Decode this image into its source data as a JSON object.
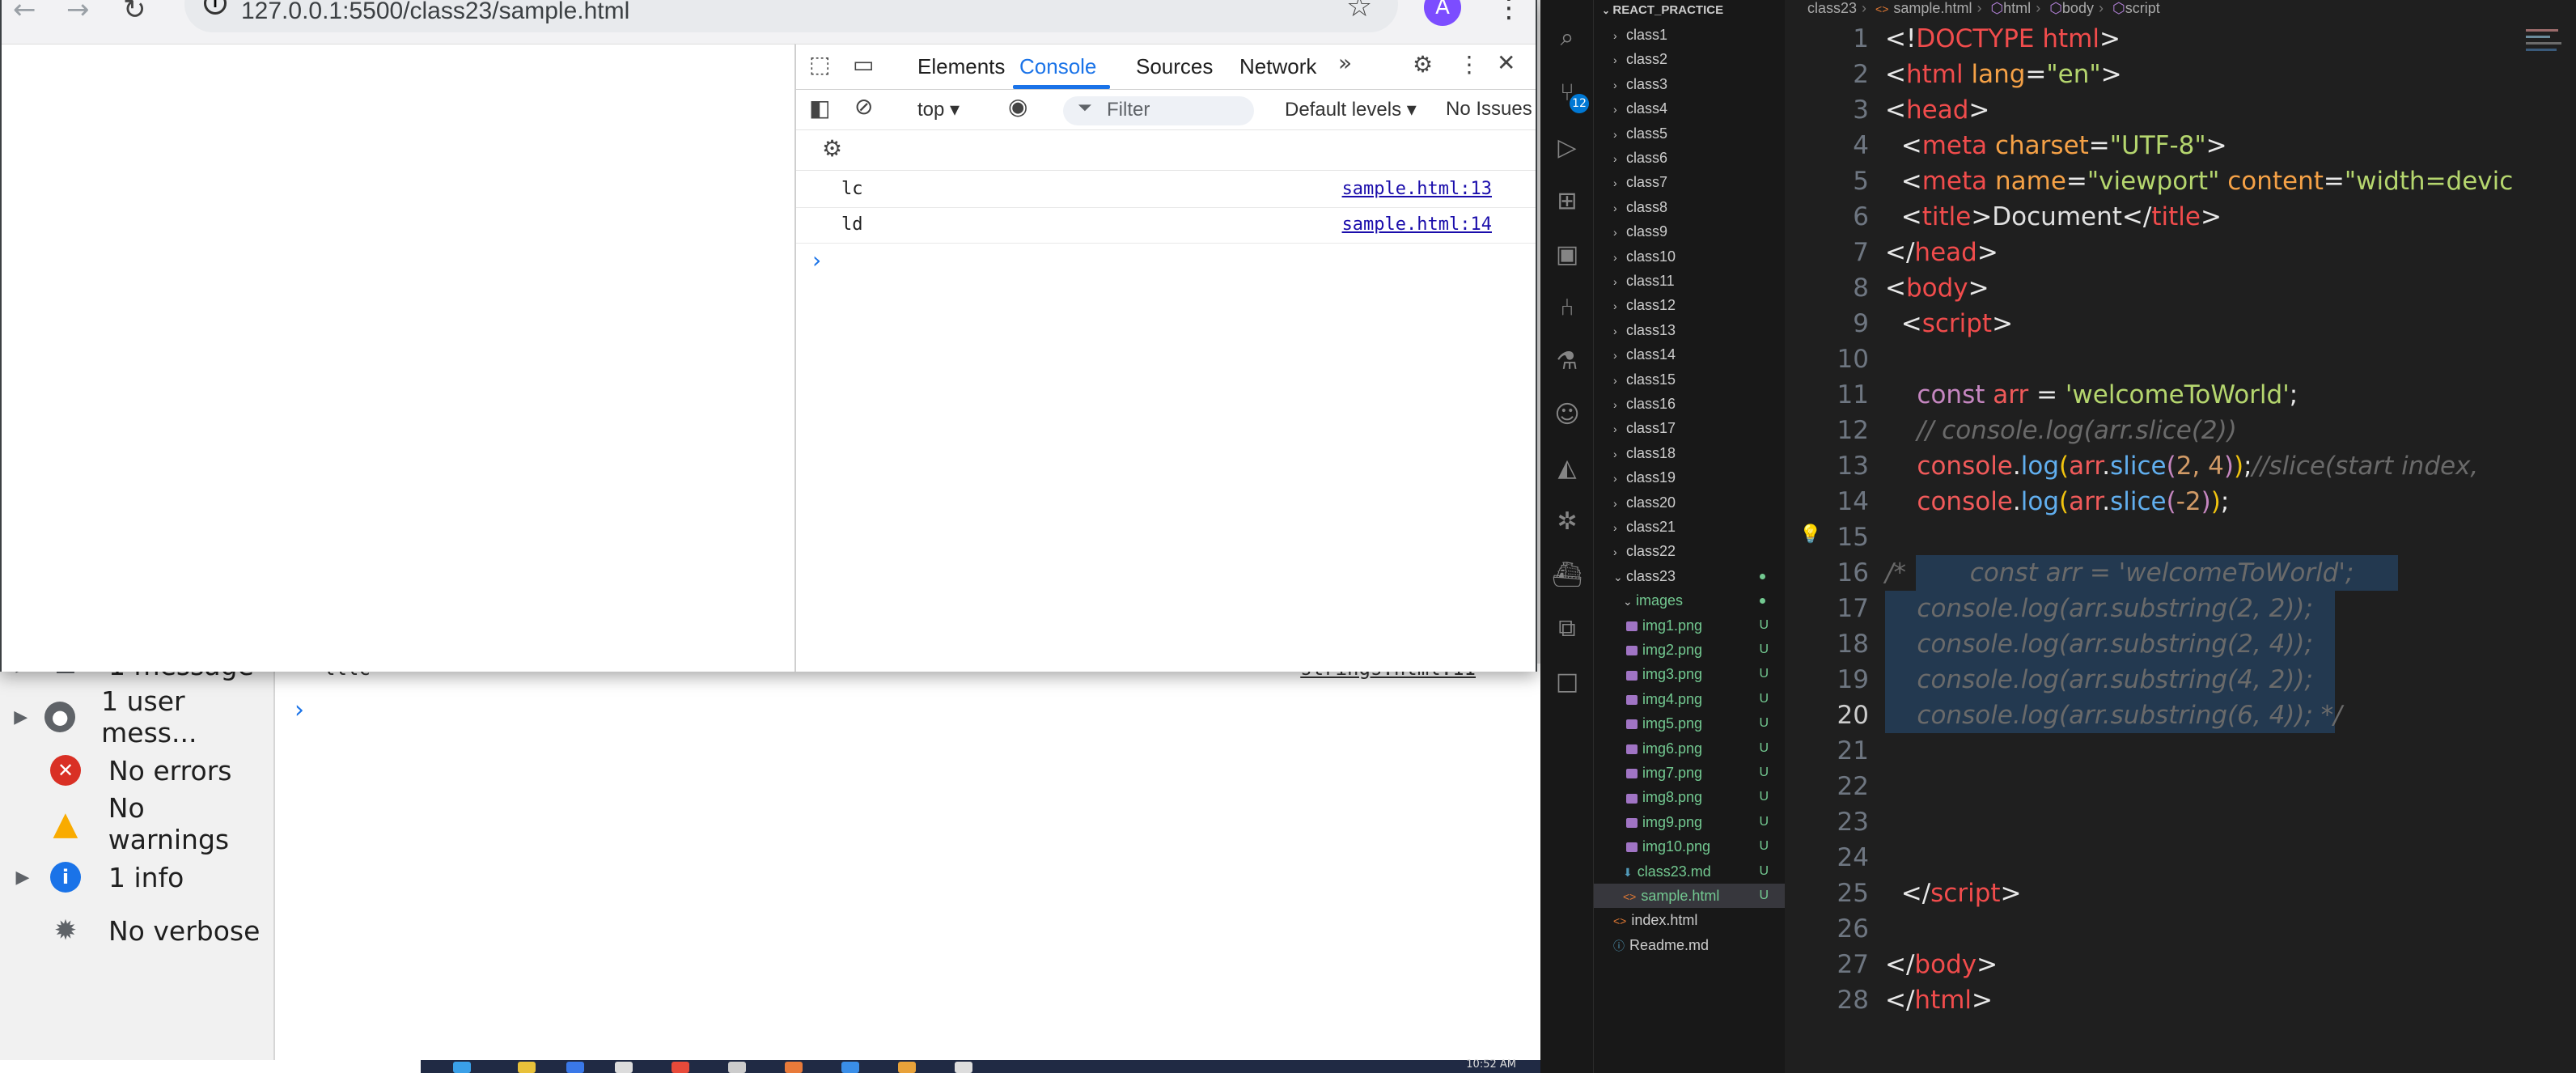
{
  "browser": {
    "url": "127.0.0.1:5500/class23/sample.html",
    "avatar_letter": "A",
    "devtools": {
      "tabs": [
        "Elements",
        "Console",
        "Sources",
        "Network"
      ],
      "active_tab": "Console",
      "context": "top ▾",
      "filter_placeholder": "Filter",
      "levels": "Default levels ▾",
      "issues": "No Issues",
      "logs": [
        {
          "text": "lc",
          "source": "sample.html:13"
        },
        {
          "text": "ld",
          "source": "sample.html:14"
        }
      ]
    },
    "background_devtools": {
      "sidebar": [
        {
          "label": "1 message",
          "icon": "list-icon"
        },
        {
          "label": "1 user mess...",
          "icon": "user-icon"
        },
        {
          "label": "No errors",
          "icon": "error-icon"
        },
        {
          "label": "No warnings",
          "icon": "warning-icon"
        },
        {
          "label": "1 info",
          "icon": "info-icon"
        },
        {
          "label": "No verbose",
          "icon": "bug-icon"
        }
      ],
      "partial_row": "lllc",
      "partial_link": "strings.html:11"
    },
    "taskbar_time": "10:52 AM"
  },
  "vscode": {
    "explorer_title": "REACT_PRACTICE",
    "folders": [
      "class1",
      "class2",
      "class3",
      "class4",
      "class5",
      "class6",
      "class7",
      "class8",
      "class9",
      "class10",
      "class11",
      "class12",
      "class13",
      "class14",
      "class15",
      "class16",
      "class17",
      "class18",
      "class19",
      "class20",
      "class21",
      "class22",
      "class23"
    ],
    "images_folder": "images",
    "images": [
      "img1.png",
      "img2.png",
      "img3.png",
      "img4.png",
      "img5.png",
      "img6.png",
      "img7.png",
      "img8.png",
      "img9.png",
      "img10.png"
    ],
    "class23_files": [
      {
        "name": "class23.md",
        "status": "U"
      },
      {
        "name": "sample.html",
        "status": "U"
      }
    ],
    "root_files": [
      "index.html",
      "Readme.md"
    ],
    "untracked_mark": "U",
    "source_control_badge": "12",
    "breadcrumb": [
      "class23",
      "sample.html",
      "html",
      "body",
      "script"
    ],
    "current_line": 20,
    "lines": [
      "1",
      "2",
      "3",
      "4",
      "5",
      "6",
      "7",
      "8",
      "9",
      "10",
      "11",
      "12",
      "13",
      "14",
      "15",
      "16",
      "17",
      "18",
      "19",
      "20",
      "21",
      "22",
      "23",
      "24",
      "25",
      "26",
      "27",
      "28"
    ],
    "code": {
      "l1": "<!DOCTYPE html>",
      "l2_tag": "html",
      "l2_attr": "lang",
      "l2_val": "\"en\"",
      "l3": "head",
      "l4_attr": "charset",
      "l4_val": "\"UTF-8\"",
      "l5_attr1": "name",
      "l5_val1": "\"viewport\"",
      "l5_attr2": "content",
      "l5_val2": "\"width=devic",
      "l6_text": "Document",
      "l11_val": "'welcomeToWorld'",
      "l12": "// console.log(arr.slice(2))",
      "l13_args": "2, 4",
      "l13_comment": "//slice(start index,",
      "l14_args": "-2",
      "l16": "/*        const arr = 'welcomeToWorld';",
      "l17": "    console.log(arr.substring(2, 2));",
      "l18": "    console.log(arr.substring(2, 4));",
      "l19": "    console.log(arr.substring(4, 2));",
      "l20": "    console.log(arr.substring(6, 4));",
      "l20_end": " */"
    }
  }
}
